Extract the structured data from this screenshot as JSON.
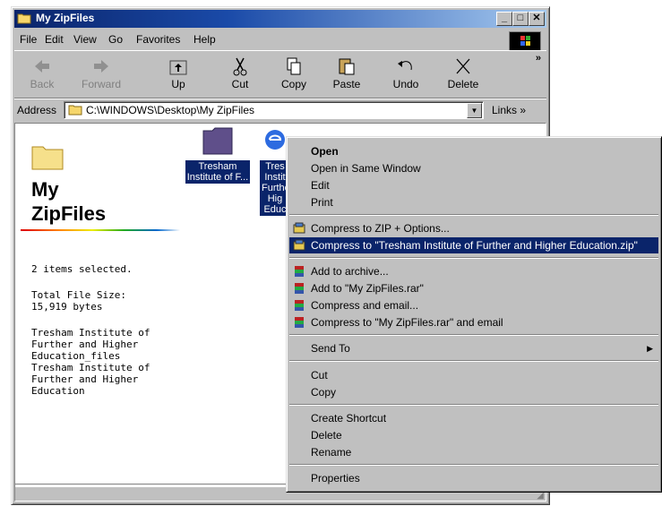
{
  "window": {
    "title": "My ZipFiles",
    "title_icon": "folder-icon"
  },
  "menubar": [
    "File",
    "Edit",
    "View",
    "Go",
    "Favorites",
    "Help"
  ],
  "toolbar": {
    "back": "Back",
    "forward": "Forward",
    "up": "Up",
    "cut": "Cut",
    "copy": "Copy",
    "paste": "Paste",
    "undo": "Undo",
    "delete": "Delete"
  },
  "address": {
    "label": "Address",
    "value": "C:\\WINDOWS\\Desktop\\My ZipFiles",
    "links": "Links"
  },
  "panel": {
    "title_line1": "My",
    "title_line2": "ZipFiles",
    "selected": "2 items selected.",
    "size_label": "Total File Size:",
    "size_value": "15,919 bytes",
    "names": [
      "Tresham Institute of",
      "Further and Higher",
      "Education_files",
      "Tresham Institute of",
      "Further and Higher",
      "Education"
    ]
  },
  "files": [
    {
      "label_line1": "Tresham",
      "label_line2": "Institute of F..."
    },
    {
      "label_lines": [
        "Tres",
        "Instit",
        "Furthe",
        "Hig",
        "Educ"
      ]
    }
  ],
  "context_menu": {
    "items": [
      {
        "label": "Open",
        "style": "bold"
      },
      {
        "label": "Open in Same Window"
      },
      {
        "label": "Edit"
      },
      {
        "label": "Print"
      },
      {
        "label": "Compress to ZIP + Options..."
      },
      {
        "label": "Compress to \"Tresham Institute of Further and Higher Education.zip\"",
        "highlighted": true
      },
      {
        "label": "Add to archive..."
      },
      {
        "label": "Add to \"My ZipFiles.rar\""
      },
      {
        "label": "Compress and email..."
      },
      {
        "label": "Compress to \"My ZipFiles.rar\" and email"
      },
      {
        "label": "Send To"
      },
      {
        "label": "Cut"
      },
      {
        "label": "Copy"
      },
      {
        "label": "Create Shortcut"
      },
      {
        "label": "Delete"
      },
      {
        "label": "Rename"
      },
      {
        "label": "Properties"
      }
    ]
  },
  "colors": {
    "titlebar": "#0a246a",
    "highlight": "#0a246a",
    "face": "#c0c0c0"
  }
}
